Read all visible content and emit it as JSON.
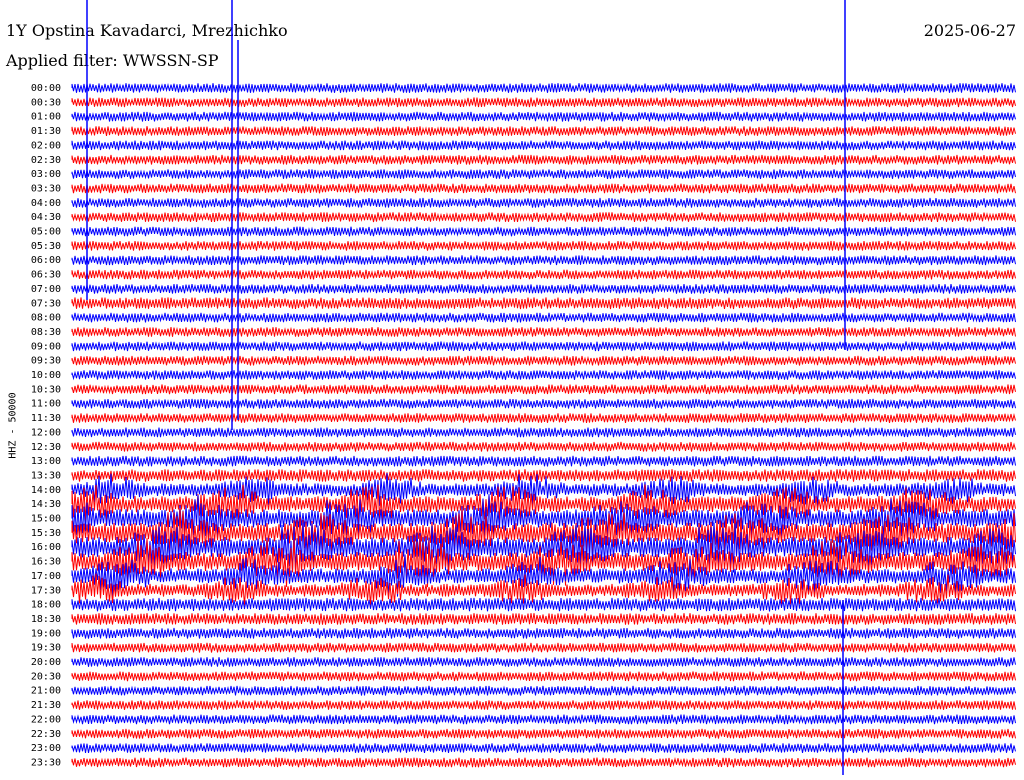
{
  "header": {
    "station": "1Y Opstina Kavadarci, Mrezhichko",
    "date": "2025-06-27",
    "filter": "Applied filter: WWSSN-SP"
  },
  "chart_data": {
    "type": "line",
    "title": "1Y Opstina Kavadarci, Mrezhichko",
    "ylabel": "HHZ - 50000",
    "xlabel": "",
    "trace_colors": [
      "#0000ff",
      "#ff0000"
    ],
    "line_labels": [
      "00:00",
      "00:30",
      "01:00",
      "01:30",
      "02:00",
      "02:30",
      "03:00",
      "03:30",
      "04:00",
      "04:30",
      "05:00",
      "05:30",
      "06:00",
      "06:30",
      "07:00",
      "07:30",
      "08:00",
      "08:30",
      "09:00",
      "09:30",
      "10:00",
      "10:30",
      "11:00",
      "11:30",
      "12:00",
      "12:30",
      "13:00",
      "13:30",
      "14:00",
      "14:30",
      "15:00",
      "15:30",
      "16:00",
      "16:30",
      "17:00",
      "17:30",
      "18:00",
      "18:30",
      "19:00",
      "19:30",
      "20:00",
      "20:30",
      "21:00",
      "21:30",
      "22:00",
      "22:30",
      "23:00",
      "23:30"
    ],
    "noise_level": [
      1,
      1,
      1,
      1,
      1,
      1,
      1,
      1,
      1,
      1,
      1,
      1,
      1,
      1,
      1,
      1.2,
      1,
      1,
      1,
      1,
      1,
      1,
      1,
      1,
      1,
      1,
      1.1,
      1.3,
      2.2,
      2.8,
      3.2,
      3.5,
      3.5,
      3.3,
      2.6,
      2.2,
      1.4,
      1.2,
      1.1,
      1,
      1,
      1,
      1,
      1,
      1,
      1,
      1,
      1
    ]
  }
}
